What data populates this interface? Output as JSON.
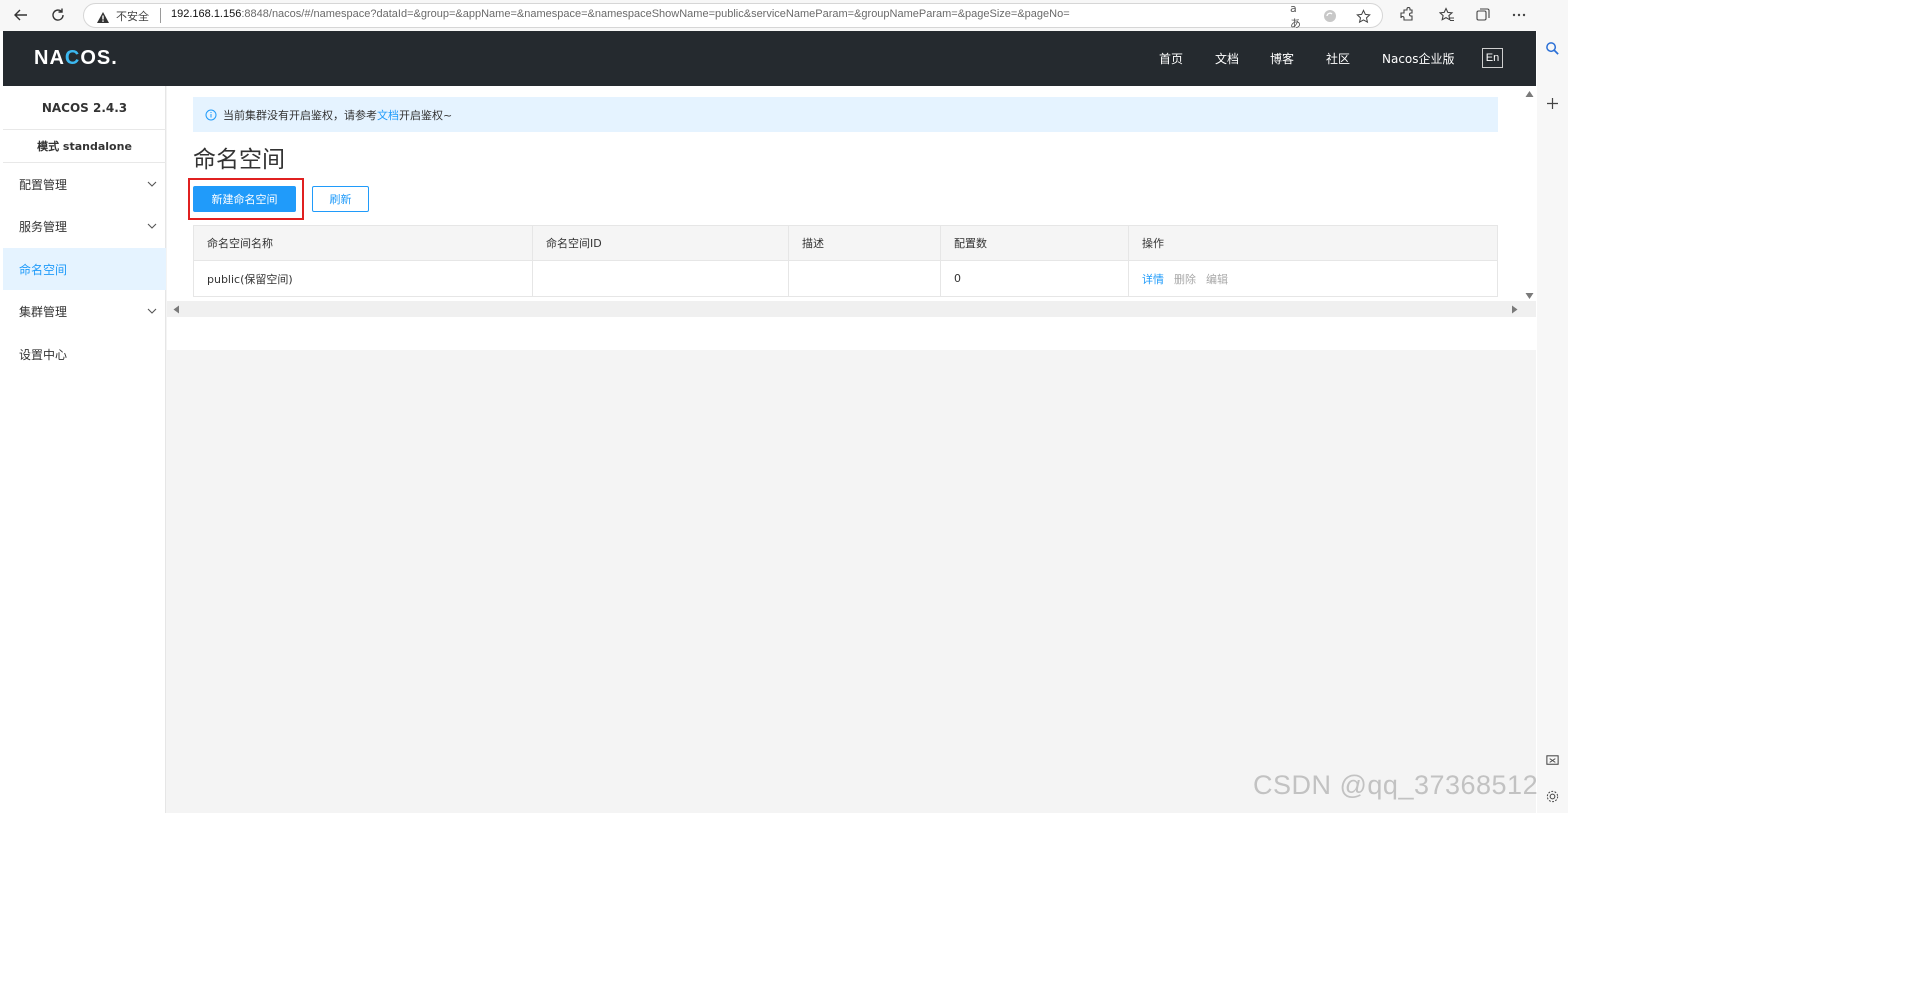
{
  "browser": {
    "insecure_label": "不安全",
    "url_host": "192.168.1.156",
    "url_rest": ":8848/nacos/#/namespace?dataId=&group=&appName=&namespace=&namespaceShowName=public&serviceNameParam=&groupNameParam=&pageSize=&pageNo=",
    "read_aloud_label": "aあ"
  },
  "header": {
    "logo_pre": "NA",
    "logo_o": "C",
    "logo_post": "OS.",
    "nav": [
      "首页",
      "文档",
      "博客",
      "社区",
      "Nacos企业版"
    ],
    "lang_label": "En"
  },
  "sidebar": {
    "version": "NACOS 2.4.3",
    "mode": "模式 standalone",
    "items": [
      {
        "label": "配置管理",
        "expandable": true,
        "active": false
      },
      {
        "label": "服务管理",
        "expandable": true,
        "active": false
      },
      {
        "label": "命名空间",
        "expandable": false,
        "active": true
      },
      {
        "label": "集群管理",
        "expandable": true,
        "active": false
      },
      {
        "label": "设置中心",
        "expandable": false,
        "active": false
      }
    ]
  },
  "notice": {
    "text_before": "当前集群没有开启鉴权，请参考",
    "link": "文档",
    "text_after": "开启鉴权~"
  },
  "page": {
    "title": "命名空间",
    "new_button": "新建命名空间",
    "refresh_button": "刷新"
  },
  "table": {
    "columns": [
      "命名空间名称",
      "命名空间ID",
      "描述",
      "配置数",
      "操作"
    ],
    "rows": [
      {
        "name": "public(保留空间)",
        "id": "",
        "desc": "",
        "config_count": "0",
        "ops": [
          "详情",
          "删除",
          "编辑"
        ]
      }
    ]
  },
  "watermark": "CSDN @qq_37368512",
  "colors": {
    "accent": "#209bfa",
    "header_bg": "#252a2f",
    "highlight": "#e02020",
    "notice_bg": "#e5f3ff"
  }
}
